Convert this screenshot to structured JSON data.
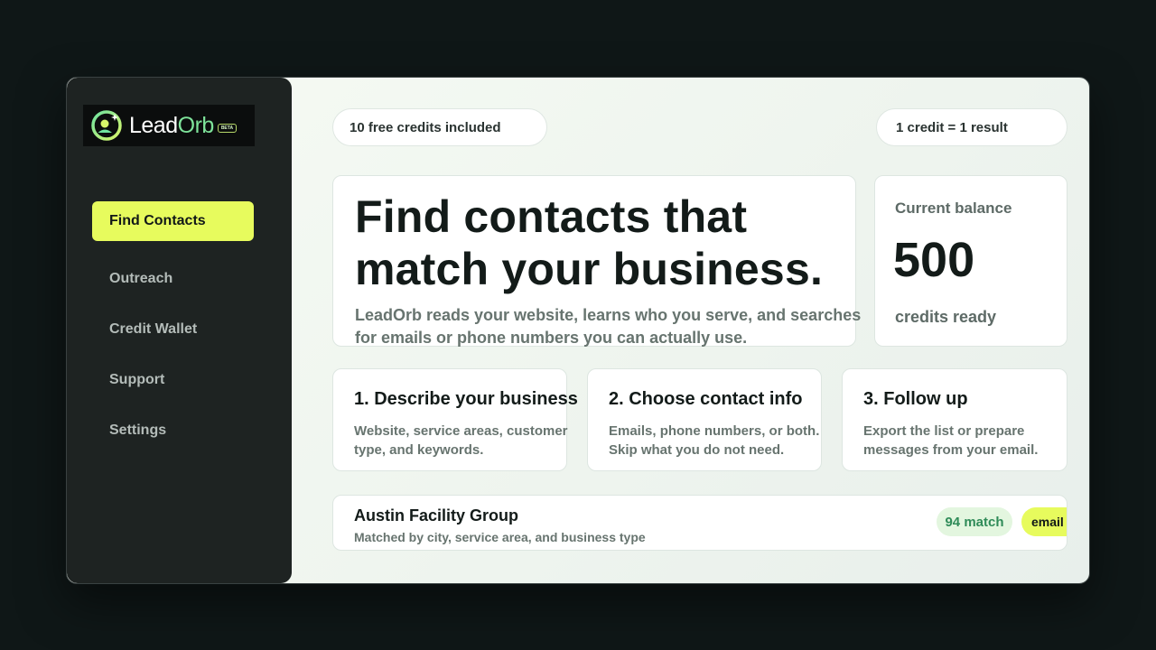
{
  "brand": {
    "name_lead": "Lead",
    "name_orb": "Orb",
    "beta_label": "BETA"
  },
  "sidebar": {
    "items": [
      {
        "label": "Find Contacts",
        "active": true
      },
      {
        "label": "Outreach",
        "active": false
      },
      {
        "label": "Credit Wallet",
        "active": false
      },
      {
        "label": "Support",
        "active": false
      },
      {
        "label": "Settings",
        "active": false
      }
    ]
  },
  "header": {
    "free_credits": "10 free credits included",
    "credit_rate": "1 credit = 1 result"
  },
  "hero": {
    "title": "Find contacts that match your business.",
    "subtitle": "LeadOrb reads your website, learns who you serve, and searches for emails or phone numbers you can actually use."
  },
  "balance": {
    "label": "Current balance",
    "value": "500",
    "unit": "credits ready"
  },
  "steps": [
    {
      "title": "1. Describe your business",
      "desc": "Website, service areas, customer type, and keywords."
    },
    {
      "title": "2. Choose contact info",
      "desc": "Emails, phone numbers, or both. Skip what you do not need."
    },
    {
      "title": "3. Follow up",
      "desc": "Export the list or prepare messages from your email."
    }
  ],
  "result": {
    "name": "Austin Facility Group",
    "meta": "Matched by city, service area, and business type",
    "match": "94 match",
    "type": "email"
  },
  "colors": {
    "accent": "#e7fb5d",
    "sidebar_bg": "#1e2322",
    "page_bg": "#0f1717",
    "match_green": "#2f8b58"
  }
}
